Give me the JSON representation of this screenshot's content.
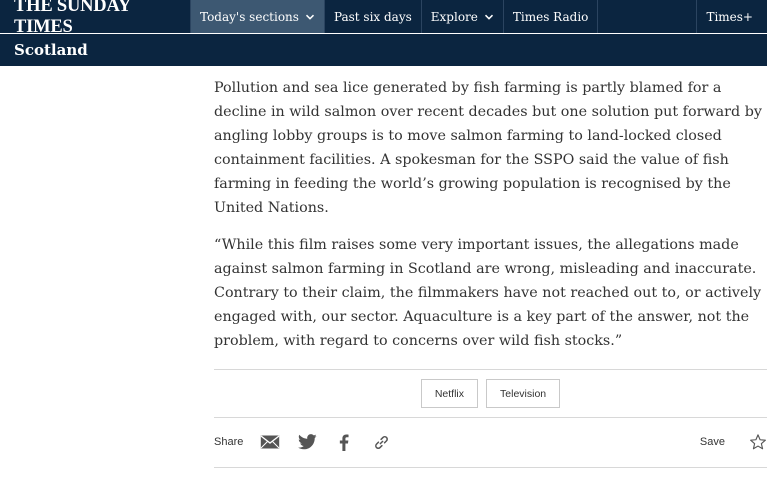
{
  "header": {
    "logo": "THE SUNDAY TIMES",
    "nav": [
      {
        "label": "Today's sections",
        "has_chevron": true,
        "active": true
      },
      {
        "label": "Past six days",
        "has_chevron": false,
        "active": false
      },
      {
        "label": "Explore",
        "has_chevron": true,
        "active": false
      },
      {
        "label": "Times Radio",
        "has_chevron": false,
        "active": false
      }
    ],
    "right_link": "Times+"
  },
  "section_title": "Scotland",
  "article": {
    "paragraphs": [
      "Pollution and sea lice generated by fish farming is partly blamed for a decline in wild salmon over recent decades but one solution put forward by angling lobby groups is to move salmon farming to land-locked closed containment facilities. A spokesman for the SSPO said the value of fish farming in feeding the world’s growing population is recognised by the United Nations.",
      "“While this film raises some very important issues, the allegations made against salmon farming in Scotland are wrong, misleading and inaccurate. Contrary to their claim, the filmmakers have not reached out to, or actively engaged with, our sector. Aquaculture is a key part of the answer, not the problem, with regard to concerns over wild fish stocks.”"
    ]
  },
  "tags": [
    "Netflix",
    "Television"
  ],
  "share": {
    "label": "Share",
    "icons": [
      "email-icon",
      "twitter-icon",
      "facebook-icon",
      "link-icon"
    ],
    "save_label": "Save",
    "save_icon": "star-icon"
  },
  "colors": {
    "header_bg": "#0b2540",
    "nav_active_bg": "#3d5872",
    "text": "#333333",
    "icon": "#555555",
    "divider": "#d8d8d8"
  }
}
